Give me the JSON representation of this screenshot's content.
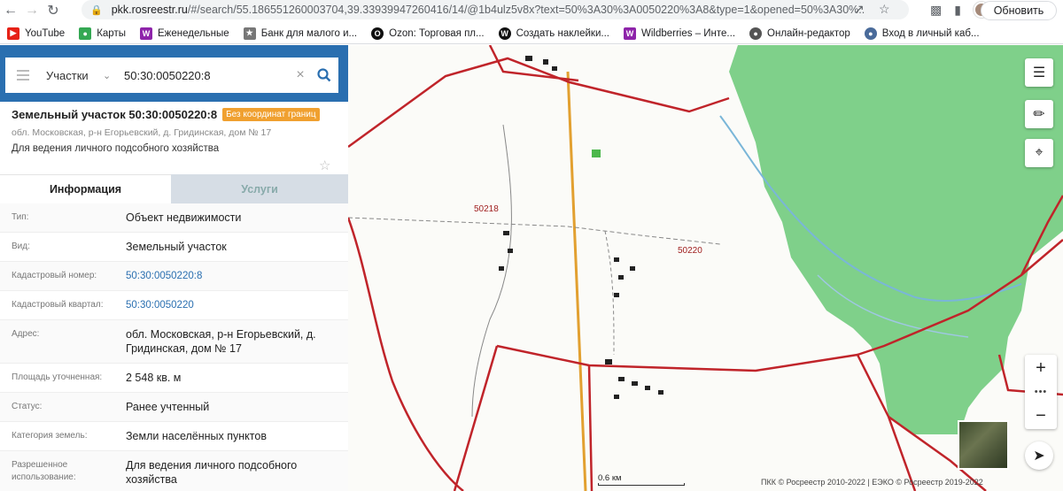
{
  "browser": {
    "url_host": "pkk.rosreestr.ru",
    "url_path": "/#/search/55.186551260003704,39.33939947260416/14/@1b4ulz5v8x?text=50%3A30%3A0050220%3A8&type=1&opened=50%3A30%...",
    "update_label": "Обновить",
    "bookmarks": [
      {
        "label": "YouTube",
        "icon": "youtube-icon",
        "color": "#e62117"
      },
      {
        "label": "Карты",
        "icon": "maps-icon",
        "color": "#34a853"
      },
      {
        "label": "Еженедельные",
        "icon": "wildberries-icon",
        "color": "#8e24aa"
      },
      {
        "label": "Банк для малого и...",
        "icon": "bank-icon",
        "color": "#777777"
      },
      {
        "label": "Ozon: Торговая пл...",
        "icon": "ozon-icon",
        "color": "#111111"
      },
      {
        "label": "Создать наклейки...",
        "icon": "w-icon",
        "color": "#111111"
      },
      {
        "label": "Wildberries – Инте...",
        "icon": "wildberries-icon",
        "color": "#8e24aa"
      },
      {
        "label": "Онлайн-редактор",
        "icon": "globe-icon",
        "color": "#555555"
      },
      {
        "label": "Вход в личный каб...",
        "icon": "fns-icon",
        "color": "#4a6b9a"
      }
    ]
  },
  "search": {
    "type_label": "Участки",
    "value": "50:30:0050220:8"
  },
  "parcel": {
    "title": "Земельный участок 50:30:0050220:8",
    "badge": "Без координат границ",
    "address_small": "обл. Московская, р-н Егорьевский, д. Гридинская, дом № 17",
    "use": "Для ведения личного подсобного хозяйства"
  },
  "tabs": {
    "info": "Информация",
    "services": "Услуги"
  },
  "rows": [
    {
      "k": "Тип:",
      "v": "Объект недвижимости"
    },
    {
      "k": "Вид:",
      "v": "Земельный участок"
    },
    {
      "k": "Кадастровый номер:",
      "v": "50:30:0050220:8"
    },
    {
      "k": "Кадастровый квартал:",
      "v": "50:30:0050220"
    },
    {
      "k": "Адрес:",
      "v": "обл. Московская, р-н Егорьевский, д. Гридинская, дом № 17"
    },
    {
      "k": "Площадь уточненная:",
      "v": "2 548 кв. м"
    },
    {
      "k": "Статус:",
      "v": "Ранее учтенный"
    },
    {
      "k": "Категория земель:",
      "v": "Земли населённых пунктов"
    },
    {
      "k": "Разрешенное использование:",
      "v": "Для ведения личного подсобного хозяйства"
    }
  ],
  "map": {
    "label_a": "50218",
    "label_b": "50220",
    "scale": "0.6 км",
    "copyright": "ПКК © Росреестр 2010-2022 | ЕЭКО © Росреестр 2019-2022",
    "forest_color": "#7fd08a",
    "boundary_color": "#c0242a",
    "road_color": "#e2a030"
  }
}
